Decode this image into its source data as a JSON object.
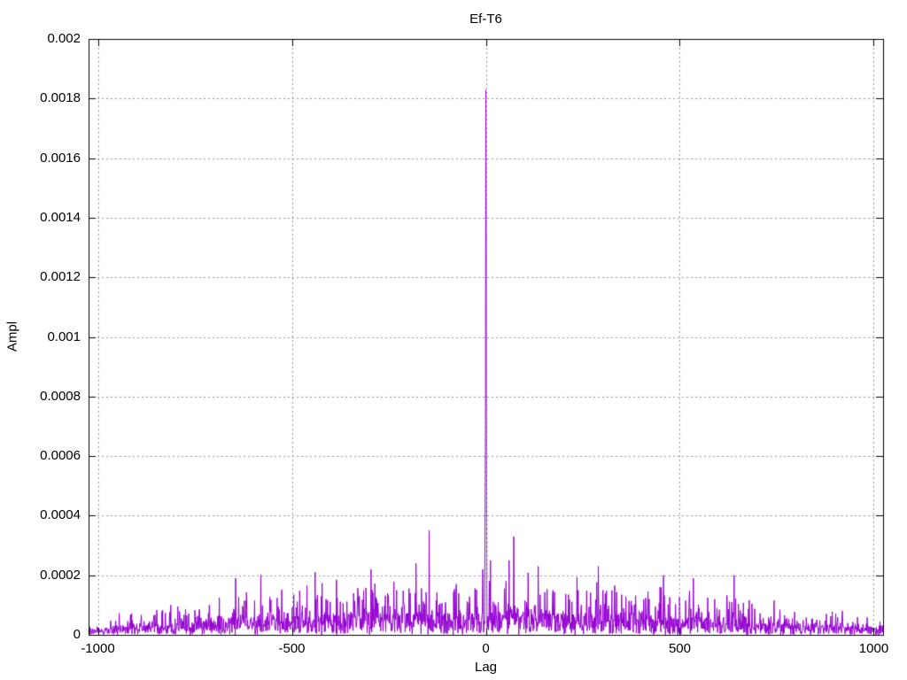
{
  "page": {
    "background": "#ffffff"
  },
  "chart_data": {
    "type": "line",
    "title": "Ef-T6",
    "xlabel": "Lag",
    "ylabel": "Ampl",
    "xlim": [
      -1024,
      1024
    ],
    "ylim": [
      0,
      0.002
    ],
    "xticks": [
      {
        "v": -1000,
        "label": "-1000"
      },
      {
        "v": -500,
        "label": "-500"
      },
      {
        "v": 0,
        "label": "0"
      },
      {
        "v": 500,
        "label": "500"
      },
      {
        "v": 1000,
        "label": "1000"
      }
    ],
    "yticks": [
      {
        "v": 0,
        "label": "0"
      },
      {
        "v": 0.0002,
        "label": "0.0002"
      },
      {
        "v": 0.0004,
        "label": "0.0004"
      },
      {
        "v": 0.0006,
        "label": "0.0006"
      },
      {
        "v": 0.0008,
        "label": "0.0008"
      },
      {
        "v": 0.001,
        "label": "0.001"
      },
      {
        "v": 0.0012,
        "label": "0.0012"
      },
      {
        "v": 0.0014,
        "label": "0.0014"
      },
      {
        "v": 0.0016,
        "label": "0.0016"
      },
      {
        "v": 0.0018,
        "label": "0.0018"
      },
      {
        "v": 0.002,
        "label": "0.002"
      }
    ],
    "grid": {
      "show": true,
      "line_style": "dotted",
      "color": "#969696"
    },
    "border_color": "#000000",
    "background": "#ffffff",
    "legend": "none",
    "series": [
      {
        "name": "Ef-T6",
        "style": "lines",
        "color": "#9400d3",
        "peaks": [
          [
            -2,
            0.00038
          ],
          [
            -1,
            0.00066
          ],
          [
            0,
            0.00183
          ],
          [
            1,
            0.00131
          ],
          [
            2,
            0.00047
          ],
          [
            -146,
            0.00035
          ],
          [
            72,
            0.00033
          ],
          [
            -180,
            0.00024
          ],
          [
            -8,
            0.00022
          ],
          [
            12,
            0.00025
          ],
          [
            60,
            0.00025
          ],
          [
            135,
            0.00023
          ],
          [
            290,
            0.00023
          ],
          [
            -296,
            0.00022
          ],
          [
            -440,
            0.00021
          ],
          [
            -580,
            0.0002
          ],
          [
            458,
            0.0002
          ],
          [
            535,
            0.00019
          ],
          [
            -645,
            0.00019
          ],
          [
            640,
            0.0002
          ]
        ],
        "noise_model": {
          "seed": 77,
          "lag_min": -1024,
          "lag_max": 1023,
          "max_center": 0.00022,
          "max_edge": 6e-05,
          "falloff_power": 1.2,
          "uniform_weight": 0.35,
          "spike_weight": 0.65,
          "spike_sharpness": 6
        }
      }
    ]
  }
}
